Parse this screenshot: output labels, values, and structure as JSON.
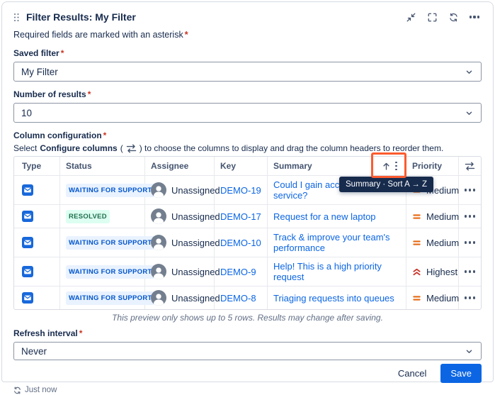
{
  "required_mark": "*",
  "header": {
    "title": "Filter Results: My Filter"
  },
  "required_note": "Required fields are marked with an asterisk",
  "fields": {
    "saved_filter": {
      "label": "Saved filter",
      "value": "My Filter"
    },
    "number_of_results": {
      "label": "Number of results",
      "value": "10"
    },
    "refresh_interval": {
      "label": "Refresh interval",
      "value": "Never"
    }
  },
  "column_config": {
    "label": "Column configuration",
    "desc_select": "Select",
    "desc_bold": "Configure columns",
    "desc_open": "(",
    "desc_close": ") to choose the columns to display and drag the column headers to reorder them."
  },
  "table": {
    "headers": {
      "type": "Type",
      "status": "Status",
      "assignee": "Assignee",
      "key": "Key",
      "summary": "Summary",
      "priority": "Priority"
    },
    "sort_tooltip": "Summary · Sort A → Z",
    "rows": [
      {
        "status": "WAITING FOR SUPPORT",
        "assignee": "Unassigned",
        "key": "DEMO-19",
        "summary": "Could I gain access to the service?",
        "priority": "Medium"
      },
      {
        "status": "RESOLVED",
        "assignee": "Unassigned",
        "key": "DEMO-17",
        "summary": "Request for a new laptop",
        "priority": "Medium"
      },
      {
        "status": "WAITING FOR SUPPORT",
        "assignee": "Unassigned",
        "key": "DEMO-10",
        "summary": "Track & improve your team's performance",
        "priority": "Medium"
      },
      {
        "status": "WAITING FOR SUPPORT",
        "assignee": "Unassigned",
        "key": "DEMO-9",
        "summary": "Help! This is a high priority request",
        "priority": "Highest"
      },
      {
        "status": "WAITING FOR SUPPORT",
        "assignee": "Unassigned",
        "key": "DEMO-8",
        "summary": "Triaging requests into queues",
        "priority": "Medium"
      }
    ],
    "preview_note": "This preview only shows up to 5 rows. Results may change after saving."
  },
  "actions": {
    "cancel": "Cancel",
    "save": "Save"
  },
  "footer": {
    "last_refreshed": "Just now"
  },
  "icons": {
    "drag_handle": "six-dot-grip",
    "minimize": "arrows-inward",
    "expand": "corner-brackets",
    "refresh": "circular-arrows",
    "more": "horizontal-ellipsis",
    "select_chevron": "chevron-down",
    "configure_columns": "horizontal-swap-arrows",
    "sort_ascending": "arrow-up",
    "column_menu": "vertical-ellipsis",
    "row_actions": "horizontal-ellipsis",
    "avatar": "person-silhouette",
    "request_type": "blue-envelope-square",
    "priority_medium": "orange-equals",
    "priority_highest": "red-double-chevron-up"
  },
  "colors": {
    "accent_blue": "#0C66E4",
    "highlight_orange": "#FC5B2F",
    "status_inprogress_bg": "#E9F2FF",
    "status_inprogress_text": "#0055CC",
    "status_done_bg": "#DCFFF1",
    "status_done_text": "#216E4E",
    "priority_medium": "#E56910",
    "priority_highest": "#C9372C",
    "tooltip_bg": "#172B4D"
  }
}
